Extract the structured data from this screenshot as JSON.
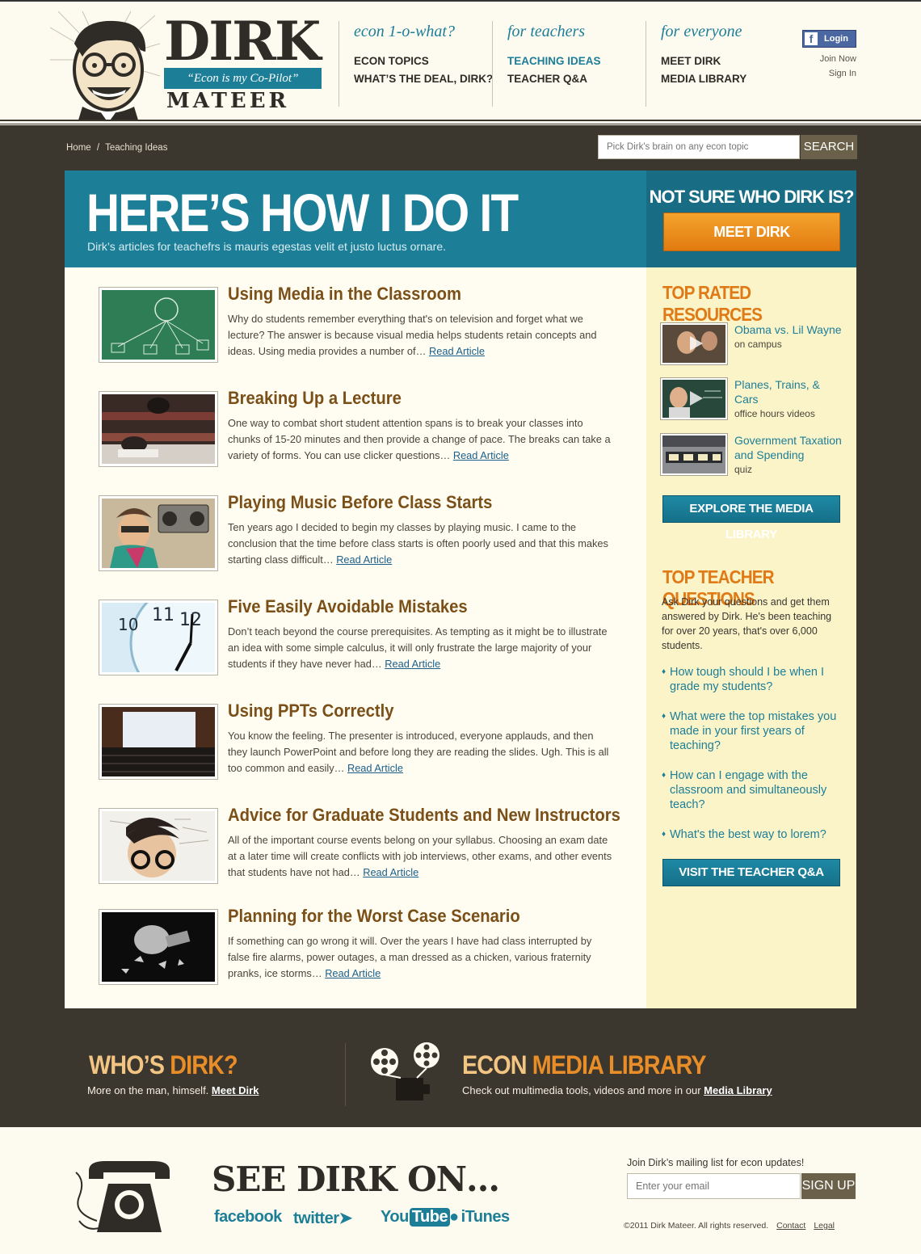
{
  "header": {
    "logo": {
      "name": "DIRK",
      "tagline": "“Econ is my Co-Pilot”",
      "surname": "MATEER"
    },
    "nav": [
      {
        "heading": "econ 1-o-what?",
        "links": [
          "ECON TOPICS",
          "WHAT’S THE DEAL, DIRK?"
        ]
      },
      {
        "heading": "for teachers",
        "links": [
          "TEACHING IDEAS",
          "TEACHER Q&A"
        ]
      },
      {
        "heading": "for everyone",
        "links": [
          "MEET DIRK",
          "MEDIA LIBRARY"
        ]
      }
    ],
    "fb_login": "Login",
    "join": "Join Now",
    "signin": "Sign In"
  },
  "breadcrumb": {
    "home": "Home",
    "sep": "/",
    "current": "Teaching Ideas"
  },
  "search": {
    "placeholder": "Pick Dirk's brain on any econ topic",
    "button": "SEARCH"
  },
  "hero": {
    "title": "HERE’S HOW I DO IT",
    "subtitle": "Dirk’s articles for teachefrs is mauris egestas velit et justo luctus ornare."
  },
  "meet": {
    "title": "NOT SURE WHO DIRK IS?",
    "button": "MEET DIRK"
  },
  "articles": [
    {
      "title": "Using Media in the Classroom",
      "body": "Why do students remember everything that's on television and forget what we lecture? The answer is because visual media helps students retain concepts and ideas. Using media provides a number of…",
      "link": "Read Article"
    },
    {
      "title": "Breaking Up a Lecture",
      "body": "One way to combat short student attention spans is to break your classes into chunks of 15-20 minutes and then provide a change of pace. The breaks can take a variety of forms. You can use clicker questions…",
      "link": "Read Article"
    },
    {
      "title": "Playing Music Before Class Starts",
      "body": "Ten years ago I decided to begin my classes by playing music. I came to the conclusion that the time before class starts is often poorly used and that this makes starting class difficult…",
      "link": "Read Article"
    },
    {
      "title": "Five Easily Avoidable Mistakes",
      "body": "Don’t teach beyond the course prerequisites. As tempting as it might be to illustrate an idea with some simple calculus, it will only frustrate the large majority of your students if they have never had…",
      "link": "Read Article"
    },
    {
      "title": "Using PPTs Correctly",
      "body": "You know the feeling. The presenter is introduced, everyone applauds, and then they launch PowerPoint and before long they are reading the slides. Ugh. This is all too common and easily…",
      "link": "Read Article"
    },
    {
      "title": "Advice for Graduate Students and New Instructors",
      "body": "All of the important course events belong on your syllabus. Choosing an exam date at a later time will create conflicts with job interviews, other exams, and other events that students have not had…",
      "link": "Read Article"
    },
    {
      "title": "Planning for the Worst Case Scenario",
      "body": "If something can go wrong it will. Over the years I have had class interrupted by false fire alarms, power outages, a man dressed as a chicken, various fraternity pranks, ice storms…",
      "link": "Read Article"
    }
  ],
  "sidebar": {
    "top_rated_heading": "TOP RATED RESOURCES",
    "resources": [
      {
        "title": "Obama vs. Lil Wayne",
        "sub": "on campus"
      },
      {
        "title": "Planes, Trains, & Cars",
        "sub": "office hours videos"
      },
      {
        "title": "Government Taxation and Spending",
        "sub": "quiz"
      }
    ],
    "explore_button": "EXPLORE THE MEDIA LIBRARY",
    "questions_heading": "TOP TEACHER QUESTIONS",
    "questions_intro": "Ask Dirk your questions and get them answered by Dirk. He's been teaching for over 20 years, that's over 6,000 students.",
    "questions": [
      "How tough should I be when I grade my students?",
      "What were the top mistakes you made in your first years of teaching?",
      "How can I engage with the classroom and simultaneously teach?",
      "What's the best way to lorem?"
    ],
    "qa_button": "VISIT THE TEACHER Q&A"
  },
  "promo": {
    "whos_a": "WHO’S ",
    "whos_b": "DIRK?",
    "whos_text": "More on the man, himself. ",
    "whos_link": "Meet Dirk",
    "media_a": "ECON ",
    "media_b": "MEDIA LIBRARY",
    "media_text": "Check out multimedia tools, videos and more in our ",
    "media_link": "Media Library"
  },
  "footer": {
    "see_title": "SEE DIRK ON…",
    "social": [
      "facebook",
      "twitter",
      "You",
      "Tube",
      "iTunes"
    ],
    "mail_label": "Join Dirk’s mailing list for econ updates!",
    "mail_placeholder": "Enter your email",
    "signup": "SIGN UP",
    "copyright": "©2011 Dirk Mateer.  All rights reserved.",
    "contact": "Contact",
    "legal": "Legal"
  },
  "colors": {
    "teal": "#1d7e97",
    "orange": "#e07a16",
    "brown": "#7a4f18",
    "dark": "#3b362e",
    "cream": "#fdfbf0",
    "sidebar": "#fbf4c9"
  }
}
